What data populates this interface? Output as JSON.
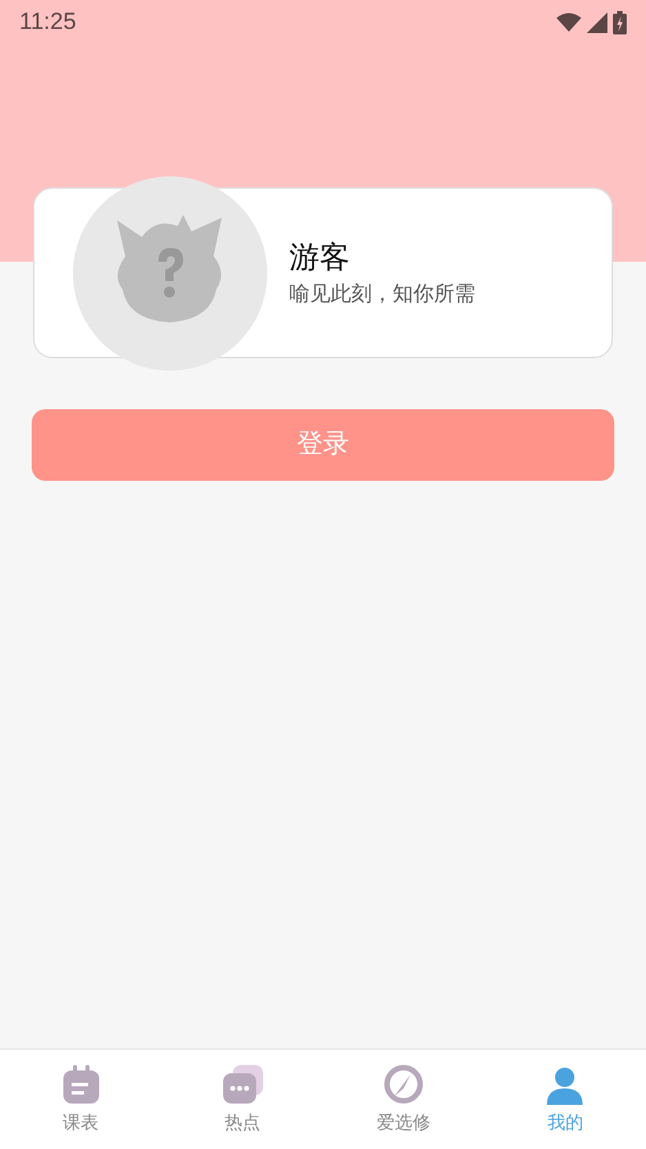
{
  "status_bar": {
    "time": "11:25"
  },
  "profile": {
    "name": "游客",
    "tagline": "喻见此刻，知你所需"
  },
  "login_button": {
    "label": "登录"
  },
  "tabs": [
    {
      "label": "课表",
      "kind": "calendar",
      "selected": false
    },
    {
      "label": "热点",
      "kind": "chat",
      "selected": false
    },
    {
      "label": "爱选修",
      "kind": "compass",
      "selected": false
    },
    {
      "label": "我的",
      "kind": "person",
      "selected": true
    }
  ]
}
